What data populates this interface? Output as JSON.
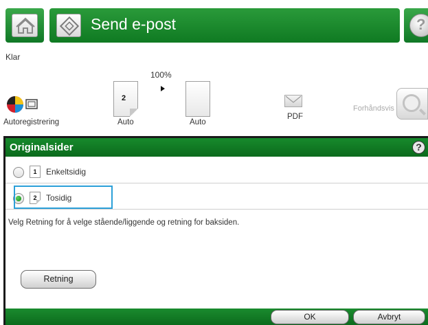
{
  "header": {
    "title": "Send e-post",
    "home_icon": "home-icon",
    "app_icon": "send-email-icon",
    "help_icon": "help-icon",
    "help_symbol": "?",
    "accent_color": "#0f7a22"
  },
  "status": {
    "text": "Klar"
  },
  "settings": {
    "zoom": "100%",
    "items": [
      {
        "label": "Autoregistrering",
        "icon": "color-mode-icon"
      },
      {
        "label": "Auto",
        "icon": "two-sided-page-icon",
        "page_number": "2"
      },
      {
        "label": "Auto",
        "icon": "page-icon"
      },
      {
        "label": "PDF",
        "icon": "pdf-envelope-icon"
      }
    ],
    "preview_label": "Forhåndsvis",
    "preview_icon": "magnifier-icon"
  },
  "dialog": {
    "title": "Originalsider",
    "help_symbol": "?",
    "options": [
      {
        "number": "1",
        "label": "Enkeltsidig",
        "selected": false
      },
      {
        "number": "2",
        "label": "Tosidig",
        "selected": true
      }
    ],
    "info": "Velg Retning for å velge stående/liggende og retning for baksiden.",
    "orientation_button": "Retning",
    "ok_button": "OK",
    "cancel_button": "Avbryt"
  }
}
